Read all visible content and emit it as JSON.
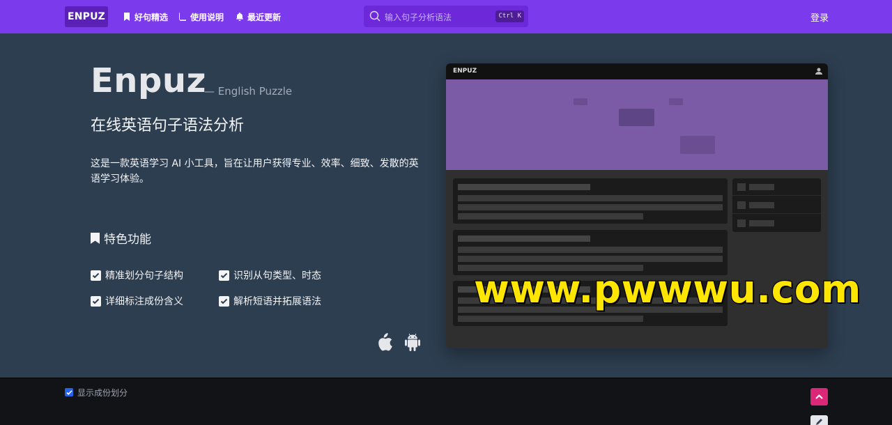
{
  "nav": {
    "brand": "ENPUZ",
    "links": [
      {
        "label": "好句精选",
        "icon": "bookmark-icon"
      },
      {
        "label": "使用说明",
        "icon": "book-icon"
      },
      {
        "label": "最近更新",
        "icon": "bell-icon"
      }
    ],
    "search": {
      "placeholder": "输入句子分析语法",
      "shortcut": "Ctrl K",
      "icon": "search-icon"
    },
    "login": "登录"
  },
  "hero": {
    "title": "Enpuz",
    "subtitle": "— English Puzzle",
    "heading": "在线英语句子语法分析",
    "description": "这是一款英语学习 AI 小工具，旨在让用户获得专业、效率、细致、发散的英语学习体验。",
    "features_title": "特色功能",
    "features": [
      "精准划分句子结构",
      "识别从句类型、时态",
      "详细标注成份含义",
      "解析短语并拓展语法"
    ],
    "platforms": [
      "apple-icon",
      "android-icon"
    ]
  },
  "preview": {
    "brand": "ENPUZ",
    "icon": "user-icon",
    "hero_color": "#7c5ba6"
  },
  "watermark": "www.pwwwu.com",
  "footer": {
    "show_parts_label": "显示成份划分",
    "show_parts_checked": true
  },
  "colors": {
    "nav": "#7c3aed",
    "body": "#2d3e50",
    "footer": "#111316",
    "back_to_top": "#db2777",
    "watermark": "#ffe600"
  }
}
